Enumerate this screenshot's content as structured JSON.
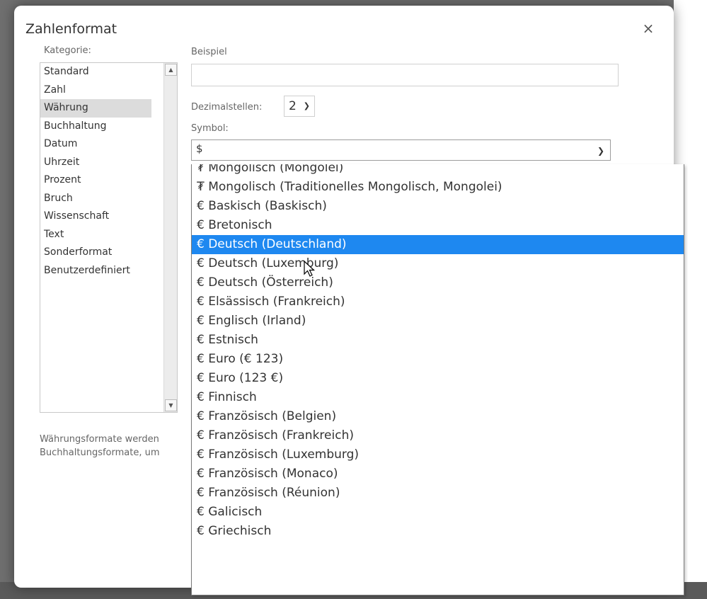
{
  "dialog": {
    "title": "Zahlenformat",
    "close_symbol": "×"
  },
  "category": {
    "label": "Kategorie:",
    "items": [
      "Standard",
      "Zahl",
      "Währung",
      "Buchhaltung",
      "Datum",
      "Uhrzeit",
      "Prozent",
      "Bruch",
      "Wissenschaft",
      "Text",
      "Sonderformat",
      "Benutzerdefiniert"
    ],
    "selected": "Währung"
  },
  "example": {
    "label": "Beispiel",
    "value": ""
  },
  "decimals": {
    "label": "Dezimalstellen:",
    "value": "2"
  },
  "symbol": {
    "label": "Symbol:",
    "value": "$"
  },
  "description": {
    "line1": "Währungsformate werden",
    "line2": "Buchhaltungsformate, um"
  },
  "symbol_options": [
    "₮ Mongolisch (Mongolei)",
    "₮ Mongolisch (Traditionelles Mongolisch, Mongolei)",
    "€ Baskisch (Baskisch)",
    "€ Bretonisch",
    "€ Deutsch (Deutschland)",
    "€ Deutsch (Luxemburg)",
    "€ Deutsch (Österreich)",
    "€ Elsässisch (Frankreich)",
    "€ Englisch (Irland)",
    "€ Estnisch",
    "€ Euro (€ 123)",
    "€ Euro (123 €)",
    "€ Finnisch",
    "€ Französisch (Belgien)",
    "€ Französisch (Frankreich)",
    "€ Französisch (Luxemburg)",
    "€ Französisch (Monaco)",
    "€ Französisch (Réunion)",
    "€ Galicisch",
    "€ Griechisch"
  ],
  "highlighted_option": "€ Deutsch (Deutschland)",
  "colors": {
    "highlight": "#1e88f0",
    "selected_category": "#dcdcdc"
  }
}
